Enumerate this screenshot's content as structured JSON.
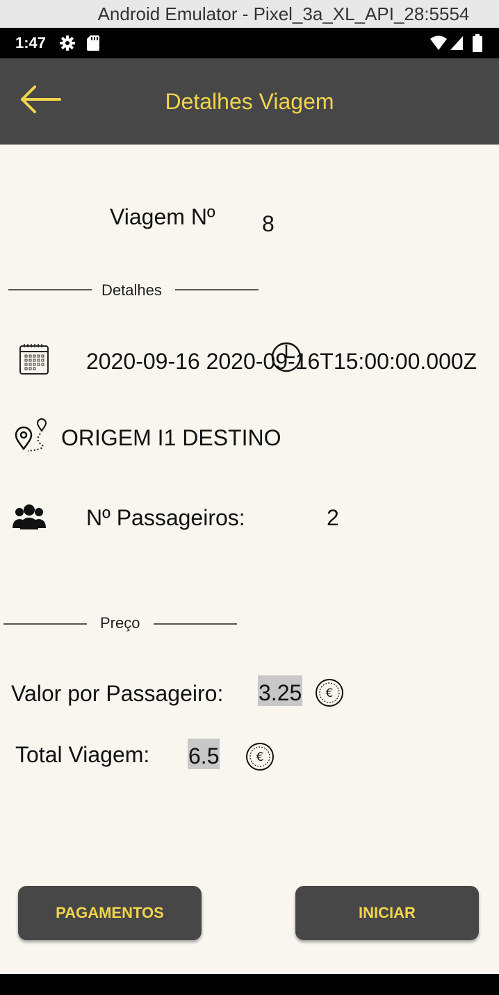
{
  "window": {
    "title": "Android Emulator - Pixel_3a_XL_API_28:5554"
  },
  "status_bar": {
    "time": "1:47"
  },
  "app_bar": {
    "title": "Detalhes Viagem",
    "back_icon": "arrow-left-icon"
  },
  "trip": {
    "label": "Viagem Nº",
    "number": "8"
  },
  "details_section": {
    "heading": "Detalhes",
    "datetime": "2020-09-16 2020-09-16T15:00:00.000Z",
    "route": "ORIGEM I1 DESTINO",
    "passengers_label": "Nº Passageiros:",
    "passengers_value": "2"
  },
  "price_section": {
    "heading": "Preço",
    "per_passenger_label": "Valor por Passageiro:",
    "per_passenger_value": "3.25",
    "total_label": "Total Viagem:",
    "total_value": "6.5"
  },
  "buttons": {
    "payments": "PAGAMENTOS",
    "start": "INICIAR"
  },
  "colors": {
    "app_bar": "#474747",
    "accent": "#f2d44d",
    "background": "#f8f6ef",
    "highlight": "#c8c8c8"
  }
}
